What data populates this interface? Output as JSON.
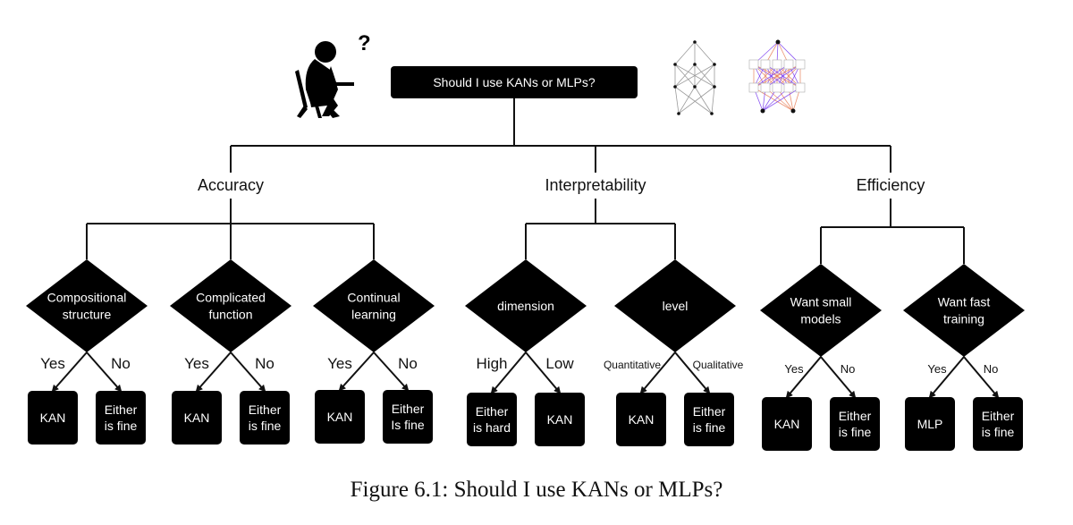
{
  "root": {
    "label": "Should I use KANs or MLPs?"
  },
  "decoration": {
    "thinker_icon": "person-thinking-icon",
    "question_mark": "?",
    "network_icons": [
      "kan-network-icon",
      "mlp-network-icon"
    ]
  },
  "categories": [
    {
      "label": "Accuracy",
      "questions": [
        {
          "label": [
            "Compositional",
            "structure"
          ],
          "branches": [
            {
              "edge": "Yes",
              "result": [
                "KAN"
              ]
            },
            {
              "edge": "No",
              "result": [
                "Either",
                "is fine"
              ]
            }
          ]
        },
        {
          "label": [
            "Complicated",
            "function"
          ],
          "branches": [
            {
              "edge": "Yes",
              "result": [
                "KAN"
              ]
            },
            {
              "edge": "No",
              "result": [
                "Either",
                "is fine"
              ]
            }
          ]
        },
        {
          "label": [
            "Continual",
            "learning"
          ],
          "branches": [
            {
              "edge": "Yes",
              "result": [
                "KAN"
              ]
            },
            {
              "edge": "No",
              "result": [
                "Either",
                "Is fine"
              ]
            }
          ]
        }
      ]
    },
    {
      "label": "Interpretability",
      "questions": [
        {
          "label": [
            "dimension"
          ],
          "branches": [
            {
              "edge": "High",
              "result": [
                "Either",
                "is hard"
              ]
            },
            {
              "edge": "Low",
              "result": [
                "KAN"
              ]
            }
          ]
        },
        {
          "label": [
            "level"
          ],
          "branches": [
            {
              "edge": "Quantitative",
              "result": [
                "KAN"
              ]
            },
            {
              "edge": "Qualitative",
              "result": [
                "Either",
                "is fine"
              ]
            }
          ]
        }
      ]
    },
    {
      "label": "Efficiency",
      "questions": [
        {
          "label": [
            "Want small",
            "models"
          ],
          "branches": [
            {
              "edge": "Yes",
              "result": [
                "KAN"
              ]
            },
            {
              "edge": "No",
              "result": [
                "Either",
                "is fine"
              ]
            }
          ]
        },
        {
          "label": [
            "Want fast",
            "training"
          ],
          "branches": [
            {
              "edge": "Yes",
              "result": [
                "MLP"
              ]
            },
            {
              "edge": "No",
              "result": [
                "Either",
                "is fine"
              ]
            }
          ]
        }
      ]
    }
  ],
  "caption": "Figure 6.1: Should I use KANs or MLPs?",
  "colors": {
    "node_fill": "#000000",
    "node_text": "#ffffff",
    "line": "#111111",
    "kan_edge_purple": "#7a3cf0",
    "kan_edge_orange": "#e8805a"
  }
}
